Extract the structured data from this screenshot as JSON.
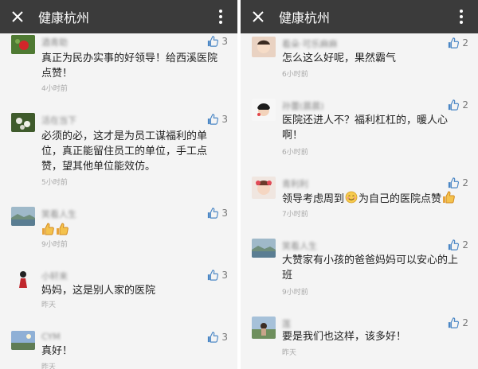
{
  "left": {
    "title": "健康杭州",
    "comments": [
      {
        "name": "酒青助",
        "text": "真正为民办实事的好领导！给西溪医院点赞！",
        "time": "4小时前",
        "likes": "3"
      },
      {
        "name": "活在当下",
        "text": "必须的必，这才是为员工谋福利的单位，真正能留住员工的单位，手工点赞，望其他单位能效仿。",
        "time": "5小时前",
        "likes": "3"
      },
      {
        "name": "笑看人生",
        "text": "",
        "time": "9小时前",
        "likes": "3",
        "emoji": [
          "thumbs-up",
          "thumbs-up"
        ]
      },
      {
        "name": "小轩来",
        "text": "妈妈，这是别人家的医院",
        "time": "昨天",
        "likes": "3"
      },
      {
        "name": "CYM",
        "text": "真好！",
        "time": "昨天",
        "likes": "3"
      }
    ]
  },
  "right": {
    "title": "健康杭州",
    "comments": [
      {
        "name": "看朵·可乐麻麻",
        "text": "怎么这么好呢，果然霸气",
        "time": "6小时前",
        "likes": "2"
      },
      {
        "name": "孙蕾(晨晨)",
        "text": "医院还进人不？福利杠杠的，暖人心啊！",
        "time": "6小时前",
        "likes": "2"
      },
      {
        "name": "青利利",
        "text_before": "领导考虑周到",
        "text_after": "为自己的医院点赞",
        "time": "7小时前",
        "likes": "2"
      },
      {
        "name": "笑看人生",
        "text": "大赞家有小孩的爸爸妈妈可以安心的上班",
        "time": "9小时前",
        "likes": "2"
      },
      {
        "name": "莲",
        "text": "要是我们也这样，该多好！",
        "time": "昨天",
        "likes": "2"
      }
    ]
  },
  "icons": {
    "close": "close-icon",
    "more": "more-vertical-icon",
    "like": "thumbs-up-icon"
  },
  "colors": {
    "topbar": "#3b3b3b",
    "like": "#4a86c5",
    "background": "#f4f4f4"
  }
}
